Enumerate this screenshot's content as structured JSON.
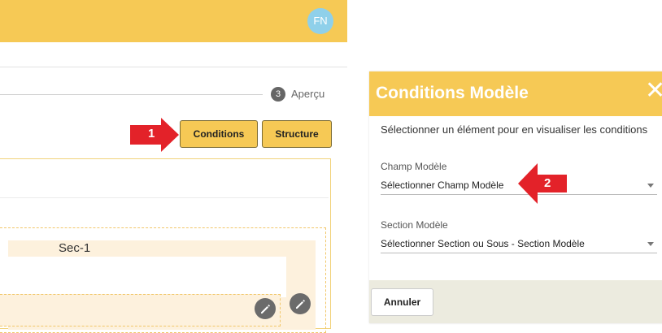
{
  "header": {
    "avatar_initials": "FN"
  },
  "stepper": {
    "step_number": "3",
    "step_label": "Aperçu"
  },
  "toolbar": {
    "conditions_label": "Conditions",
    "structure_label": "Structure"
  },
  "section": {
    "label": "Sec-1"
  },
  "annotations": {
    "arrow_1": "1",
    "arrow_2": "2"
  },
  "modal": {
    "title": "Conditions Modèle",
    "close_glyph": "✕",
    "description": "Sélectionner un élément pour en visualiser les conditions",
    "champ_label": "Champ Modèle",
    "champ_value": "Sélectionner Champ Modèle",
    "section_label": "Section Modèle",
    "section_value": "Sélectionner Section ou Sous - Section Modèle",
    "cancel_label": "Annuler"
  },
  "colors": {
    "accent": "#f6c955",
    "arrow": "#e32229",
    "avatar": "#8fd0ea",
    "footer": "#ecebdf"
  }
}
